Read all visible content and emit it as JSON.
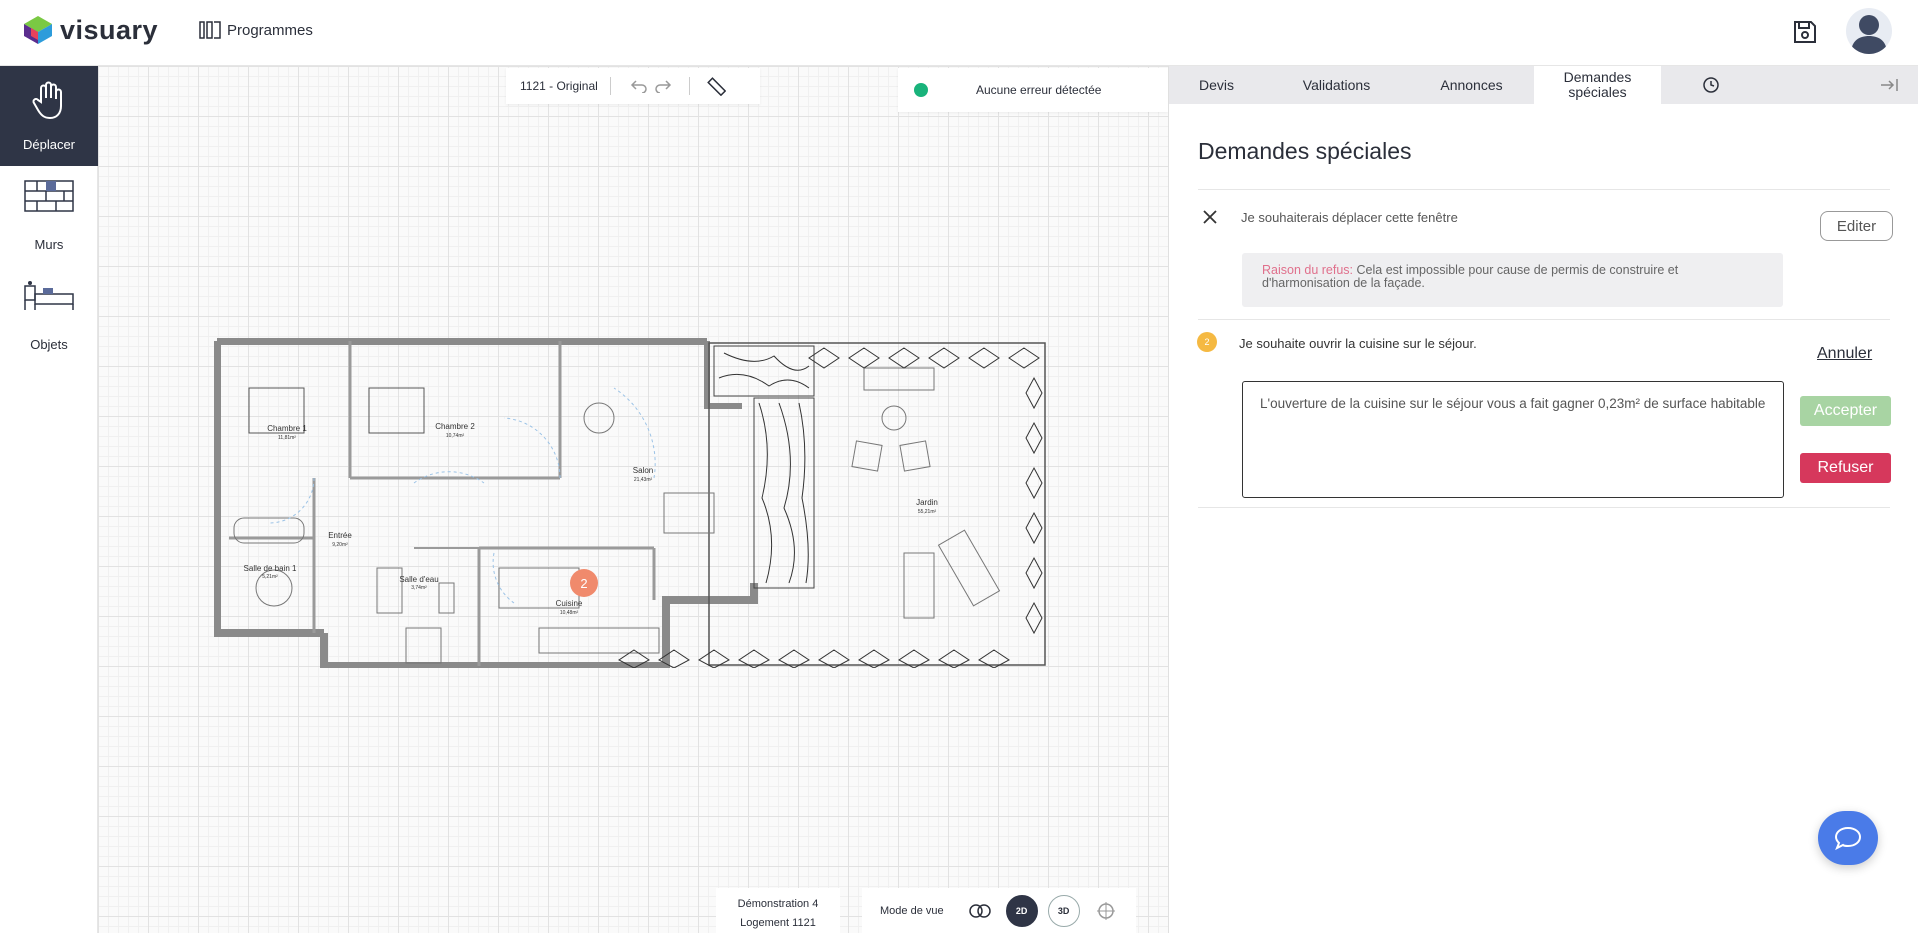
{
  "app": {
    "logo_text": "visuary",
    "programmes_label": "Programmes"
  },
  "toolbar": {
    "items": [
      {
        "label": "Déplacer",
        "icon": "hand-icon",
        "active": true
      },
      {
        "label": "Murs",
        "icon": "wall-icon",
        "active": false
      },
      {
        "label": "Objets",
        "icon": "furniture-icon",
        "active": false
      }
    ]
  },
  "canvas": {
    "version_label": "1121 - Original",
    "status_text": "Aucune erreur détectée",
    "status_color": "#19b37b",
    "marker_number": "2",
    "demo_line1": "Démonstration 4",
    "demo_line2": "Logement 1121",
    "view_mode_label": "Mode de vue",
    "view_modes": [
      "2D",
      "3D"
    ],
    "rooms": [
      {
        "name": "Chambre 1",
        "area": "11,81m²"
      },
      {
        "name": "Chambre 2",
        "area": "10,74m²"
      },
      {
        "name": "Salon",
        "area": "21,43m²"
      },
      {
        "name": "Jardin",
        "area": "55,21m²"
      },
      {
        "name": "Entrée",
        "area": "9,20m²"
      },
      {
        "name": "Salle de bain 1",
        "area": "5,21m²"
      },
      {
        "name": "Salle d'eau",
        "area": "3,74m²"
      },
      {
        "name": "Cuisine",
        "area": "10,48m²"
      }
    ]
  },
  "panel": {
    "tabs": [
      {
        "label": "Devis"
      },
      {
        "label": "Validations"
      },
      {
        "label": "Annonces"
      },
      {
        "label": "Demandes spéciales",
        "active": true
      }
    ],
    "title": "Demandes spéciales",
    "requests": [
      {
        "text": "Je souhaiterais déplacer cette fenêtre",
        "action": "Editer",
        "refusal_label": "Raison du refus:",
        "refusal_text": "Cela est impossible pour cause de permis de construire et d'harmonisation de la façade."
      },
      {
        "badge": "2",
        "text": "Je souhaite ouvrir la cuisine sur le séjour.",
        "cancel": "Annuler",
        "comment": "L'ouverture de la cuisine sur le séjour vous a fait gagner 0,23m² de surface habitable",
        "accept": "Accepter",
        "refuse": "Refuser"
      }
    ]
  }
}
